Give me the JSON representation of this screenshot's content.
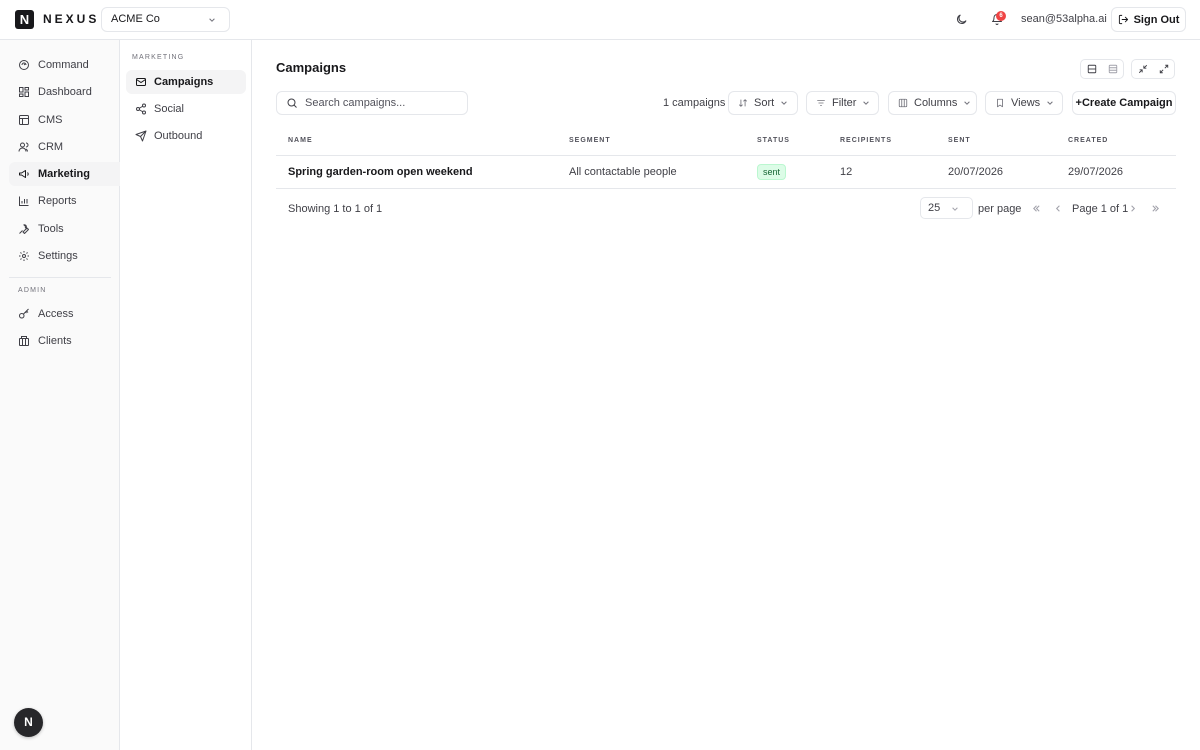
{
  "header": {
    "logo_letter": "N",
    "brand": "NEXUS",
    "org_selected": "ACME Co",
    "notification_count": "6",
    "user_email": "sean@53alpha.ai",
    "sign_out_label": "Sign Out"
  },
  "sidebar": {
    "items": [
      {
        "label": "Command",
        "icon": "command-icon"
      },
      {
        "label": "Dashboard",
        "icon": "dashboard-icon"
      },
      {
        "label": "CMS",
        "icon": "cms-icon"
      },
      {
        "label": "CRM",
        "icon": "users-icon"
      },
      {
        "label": "Marketing",
        "icon": "megaphone-icon",
        "active": true
      },
      {
        "label": "Reports",
        "icon": "bar-chart-icon"
      },
      {
        "label": "Tools",
        "icon": "wrench-icon"
      },
      {
        "label": "Settings",
        "icon": "gear-icon"
      }
    ],
    "admin_label": "ADMIN",
    "admin_items": [
      {
        "label": "Access",
        "icon": "key-icon"
      },
      {
        "label": "Clients",
        "icon": "building-icon"
      }
    ],
    "avatar_letter": "N"
  },
  "subnav": {
    "section_label": "MARKETING",
    "items": [
      {
        "label": "Campaigns",
        "icon": "mail-icon",
        "active": true
      },
      {
        "label": "Social",
        "icon": "share-icon"
      },
      {
        "label": "Outbound",
        "icon": "send-icon"
      }
    ]
  },
  "main": {
    "title": "Campaigns",
    "search_placeholder": "Search campaigns...",
    "count_text": "1 campaigns",
    "sort_label": "Sort",
    "filter_label": "Filter",
    "columns_label": "Columns",
    "views_label": "Views",
    "create_label": "+Create Campaign",
    "table": {
      "headers": [
        "NAME",
        "SEGMENT",
        "STATUS",
        "RECIPIENTS",
        "SENT",
        "CREATED"
      ],
      "rows": [
        {
          "name": "Spring garden-room open weekend",
          "segment": "All contactable people",
          "status": "sent",
          "recipients": "12",
          "sent": "20/07/2026",
          "created": "29/07/2026"
        }
      ]
    },
    "footer": {
      "showing": "Showing 1 to 1 of 1",
      "per_page_value": "25",
      "per_page_label": "per page",
      "page_indicator": "Page 1 of 1"
    }
  },
  "colors": {
    "status_sent_bg": "#dcfce7",
    "status_sent_text": "#166534",
    "notification_badge": "#ef4444",
    "brand": "#18181b"
  }
}
